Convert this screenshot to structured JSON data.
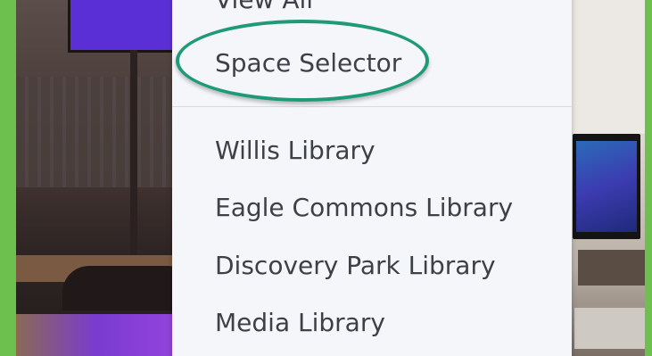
{
  "menu": {
    "items": [
      {
        "label": "View All"
      },
      {
        "label": "Space Selector"
      },
      {
        "label": "Willis Library"
      },
      {
        "label": "Eagle Commons Library"
      },
      {
        "label": "Discovery Park Library"
      },
      {
        "label": "Media Library"
      }
    ]
  },
  "colors": {
    "page_background": "#6ec04e",
    "menu_background": "#f5f6f9",
    "menu_text": "#3d4147",
    "highlight_ring": "#1f9a78"
  }
}
